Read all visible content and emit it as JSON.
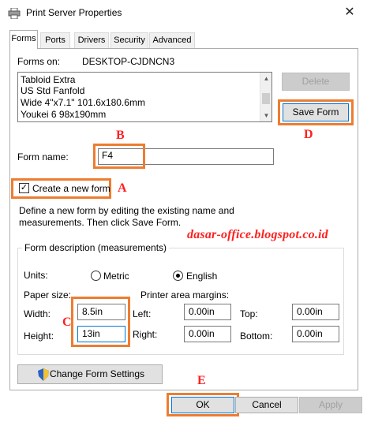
{
  "window": {
    "title": "Print Server Properties",
    "close_glyph": "✕"
  },
  "tabs": [
    {
      "label": "Forms",
      "active": true
    },
    {
      "label": "Ports",
      "active": false
    },
    {
      "label": "Drivers",
      "active": false
    },
    {
      "label": "Security",
      "active": false
    },
    {
      "label": "Advanced",
      "active": false
    }
  ],
  "forms": {
    "forms_on_label": "Forms on:",
    "server_name": "DESKTOP-CJDNCN3",
    "list_items": [
      "Tabloid Extra",
      "US Std Fanfold",
      "Wide 4\"x7.1\" 101.6x180.6mm",
      "Youkei 6 98x190mm"
    ],
    "delete_label": "Delete",
    "save_form_label": "Save Form",
    "form_name_label": "Form name:",
    "form_name_value": "F4",
    "create_new_form_label": "Create a new form",
    "create_new_form_checked": true,
    "description_line1": "Define a new form by editing the existing name and",
    "description_line2": "measurements. Then click Save Form."
  },
  "measurements": {
    "legend": "Form description (measurements)",
    "units_label": "Units:",
    "metric_label": "Metric",
    "english_label": "English",
    "selected_unit": "English",
    "paper_size_label": "Paper size:",
    "printer_margins_label": "Printer area margins:",
    "width_label": "Width:",
    "width_value": "8.5in",
    "height_label": "Height:",
    "height_value": "13in",
    "left_label": "Left:",
    "left_value": "0.00in",
    "right_label": "Right:",
    "right_value": "0.00in",
    "top_label": "Top:",
    "top_value": "0.00in",
    "bottom_label": "Bottom:",
    "bottom_value": "0.00in"
  },
  "change_settings_label": "Change Form Settings",
  "footer": {
    "ok_label": "OK",
    "cancel_label": "Cancel",
    "apply_label": "Apply"
  },
  "annotations": {
    "a": "A",
    "b": "B",
    "c": "C",
    "d": "D",
    "e": "E",
    "watermark": "dasar-office.blogspot.co.id",
    "highlight_color": "#ed7d31",
    "letter_color": "#ff2020"
  }
}
